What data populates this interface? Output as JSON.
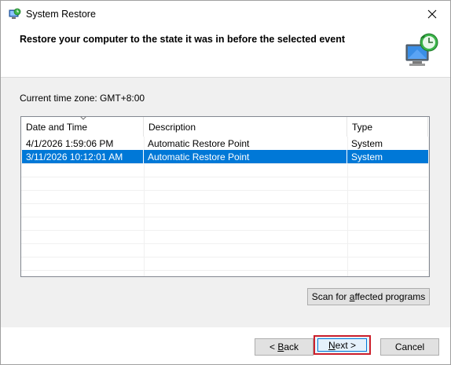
{
  "window": {
    "title": "System Restore"
  },
  "header": {
    "text": "Restore your computer to the state it was in before the selected event"
  },
  "timezone": {
    "label": "Current time zone: GMT+8:00"
  },
  "restore_points": {
    "columns": [
      "Date and Time",
      "Description",
      "Type"
    ],
    "rows": [
      {
        "date": "4/1/2026 1:59:06 PM",
        "description": "Automatic Restore Point",
        "type": "System",
        "selected": false
      },
      {
        "date": "3/11/2026 10:12:01 AM",
        "description": "Automatic Restore Point",
        "type": "System",
        "selected": true
      }
    ]
  },
  "buttons": {
    "scan_prefix": "Scan for ",
    "scan_mnemonic": "a",
    "scan_suffix": "ffected programs",
    "back_prefix": "< ",
    "back_mnemonic": "B",
    "back_suffix": "ack",
    "next_mnemonic": "N",
    "next_suffix": "ext >",
    "cancel": "Cancel"
  },
  "colors": {
    "selection": "#0078d7",
    "highlight_border": "#cc1f2b"
  }
}
